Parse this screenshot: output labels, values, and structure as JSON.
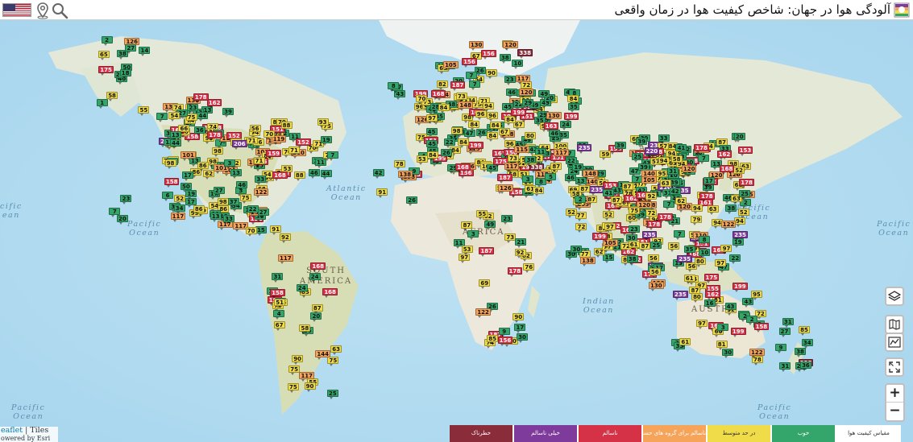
{
  "header": {
    "title": "آلودگی هوا در جهان: شاخص کیفیت هوا در زمان واقعی",
    "flag_icon": "us-flag-icon",
    "location_icon": "location-pin-icon",
    "search_icon": "search-icon",
    "logo_icon": "aqicn-logo-icon"
  },
  "map": {
    "ocean_labels": [
      {
        "id": "pacific-ne",
        "text": "Pacific\nOcean"
      },
      {
        "id": "pacific-w",
        "text": "cific\nean"
      },
      {
        "id": "atlantic",
        "text": "Atlantic\nOcean"
      },
      {
        "id": "indian",
        "text": "Indian\nOcean"
      },
      {
        "id": "pacific-e1",
        "text": "Pacific\nOcean"
      },
      {
        "id": "pacific-e2",
        "text": "Pacific\nOcean"
      },
      {
        "id": "pacific-sw",
        "text": "Pacific\nOcean"
      },
      {
        "id": "pacific-se",
        "text": "Pacific\nOcean"
      }
    ],
    "continent_labels": [
      {
        "id": "south-america",
        "text": "SOUTH\nAMERICA"
      },
      {
        "id": "africa",
        "text": "AFRICA"
      },
      {
        "id": "australia",
        "text": "AUSTRA"
      },
      {
        "id": "asia",
        "text": "A"
      }
    ],
    "colors": {
      "good": "#35a66b",
      "moderate": "#f0dc48",
      "usg": "#f5a45a",
      "unhealthy": "#d63247",
      "very_unhealthy": "#7f3b9c",
      "hazardous": "#8a2c3a"
    },
    "markers": [
      {
        "v": "40"
      },
      {
        "v": "13"
      },
      {
        "v": "5"
      },
      {
        "v": "8"
      },
      {
        "v": "34"
      },
      {
        "v": "21"
      },
      {
        "v": "56"
      },
      {
        "v": "4"
      },
      {
        "v": "3"
      },
      {
        "v": "18"
      },
      {
        "v": "20"
      },
      {
        "v": "33"
      },
      {
        "v": "73"
      },
      {
        "v": "46"
      },
      {
        "v": "50"
      },
      {
        "v": "35"
      },
      {
        "v": "17"
      },
      {
        "v": "65"
      },
      {
        "v": "71"
      },
      {
        "v": "44"
      },
      {
        "v": "38"
      },
      {
        "v": "81"
      },
      {
        "v": "100"
      },
      {
        "v": "62"
      },
      {
        "v": "91"
      },
      {
        "v": "25"
      },
      {
        "v": "30"
      },
      {
        "v": "28"
      },
      {
        "v": "54"
      },
      {
        "v": "36"
      },
      {
        "v": "80"
      },
      {
        "v": "39"
      },
      {
        "v": "55"
      },
      {
        "v": "22"
      },
      {
        "v": "6"
      },
      {
        "v": "2"
      },
      {
        "v": "60"
      },
      {
        "v": "24"
      },
      {
        "v": "68"
      },
      {
        "v": "1"
      },
      {
        "v": "10"
      },
      {
        "v": "52"
      },
      {
        "v": "45"
      },
      {
        "v": "13"
      },
      {
        "v": "37"
      },
      {
        "v": "61"
      },
      {
        "v": "57"
      },
      {
        "v": "51"
      },
      {
        "v": "53"
      },
      {
        "v": "74"
      },
      {
        "v": "58"
      },
      {
        "v": "59"
      },
      {
        "v": "67"
      },
      {
        "v": "77"
      },
      {
        "v": "88"
      },
      {
        "v": "31"
      },
      {
        "v": "41"
      },
      {
        "v": "48"
      },
      {
        "v": "7"
      },
      {
        "v": "14"
      },
      {
        "v": "97"
      },
      {
        "v": "69"
      },
      {
        "v": "85"
      },
      {
        "v": "151"
      },
      {
        "v": "152"
      },
      {
        "v": "153"
      },
      {
        "v": "155"
      },
      {
        "v": "156"
      },
      {
        "v": "158"
      },
      {
        "v": "159"
      },
      {
        "v": "161"
      },
      {
        "v": "162"
      },
      {
        "v": "163"
      },
      {
        "v": "168"
      },
      {
        "v": "171"
      },
      {
        "v": "175"
      },
      {
        "v": "178"
      },
      {
        "v": "187"
      },
      {
        "v": "199"
      },
      {
        "v": "101"
      },
      {
        "v": "105"
      },
      {
        "v": "110"
      },
      {
        "v": "115"
      },
      {
        "v": "117"
      },
      {
        "v": "119"
      },
      {
        "v": "120"
      },
      {
        "v": "122"
      },
      {
        "v": "126"
      },
      {
        "v": "130"
      },
      {
        "v": "135"
      },
      {
        "v": "138"
      },
      {
        "v": "140"
      },
      {
        "v": "144"
      },
      {
        "v": "148"
      },
      {
        "v": "206"
      },
      {
        "v": "220"
      },
      {
        "v": "235"
      },
      {
        "v": "338"
      },
      {
        "v": "72"
      },
      {
        "v": "70"
      },
      {
        "v": "47"
      },
      {
        "v": "66"
      },
      {
        "v": "64"
      },
      {
        "v": "63"
      },
      {
        "v": "27"
      },
      {
        "v": "29"
      },
      {
        "v": "19"
      },
      {
        "v": "12"
      },
      {
        "v": "11"
      },
      {
        "v": "9"
      },
      {
        "v": "16"
      },
      {
        "v": "15"
      },
      {
        "v": "26"
      },
      {
        "v": "23"
      },
      {
        "v": "32"
      },
      {
        "v": "42"
      },
      {
        "v": "43"
      },
      {
        "v": "49"
      },
      {
        "v": "75"
      },
      {
        "v": "76"
      },
      {
        "v": "78"
      },
      {
        "v": "79"
      },
      {
        "v": "82"
      },
      {
        "v": "84"
      },
      {
        "v": "86"
      },
      {
        "v": "87"
      },
      {
        "v": "89"
      },
      {
        "v": "90"
      },
      {
        "v": "92"
      },
      {
        "v": "93"
      },
      {
        "v": "94"
      },
      {
        "v": "95"
      },
      {
        "v": "96"
      },
      {
        "v": "98"
      },
      {
        "v": "99"
      }
    ]
  },
  "controls": {
    "layers_icon": "layers-icon",
    "map_icon": "map-icon",
    "stations_icon": "stations-icon",
    "fullscreen_icon": "fullscreen-icon",
    "zoom_in": "+",
    "zoom_out": "−"
  },
  "attribution": {
    "leaflet": "eaflet",
    "sep": " | Tiles",
    "powered": "owered by Esri"
  },
  "legend": {
    "title": "مقیاس کیفیت هوا",
    "levels": [
      {
        "label": "خطرناک",
        "color": "#8a2c3a"
      },
      {
        "label": "خیلی ناسالم",
        "color": "#7f3b9c"
      },
      {
        "label": "ناسالم",
        "color": "#d63247"
      },
      {
        "label": "ناسالم برای گروه های حساس",
        "color": "#f5a45a"
      },
      {
        "label": "در حد متوسط",
        "color": "#f0dc48"
      },
      {
        "label": "خوب",
        "color": "#35a66b"
      }
    ]
  }
}
